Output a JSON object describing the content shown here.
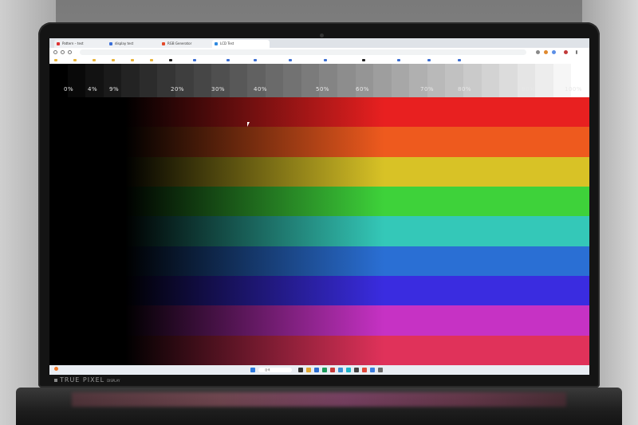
{
  "browser": {
    "tabs": [
      {
        "label": "Pattern – test"
      },
      {
        "label": "display test"
      },
      {
        "label": "RGB Generator"
      },
      {
        "label": "LCD Test"
      }
    ],
    "url": "",
    "bookmarks": [
      {
        "label": "",
        "kind": "folder"
      },
      {
        "label": "",
        "kind": "folder"
      },
      {
        "label": "",
        "kind": "folder"
      },
      {
        "label": "",
        "kind": "folder"
      },
      {
        "label": "",
        "kind": "folder"
      },
      {
        "label": "",
        "kind": "folder"
      },
      {
        "label": "",
        "kind": "dark"
      },
      {
        "label": "",
        "kind": "blue"
      },
      {
        "label": "",
        "kind": "blue"
      },
      {
        "label": "",
        "kind": "blue"
      },
      {
        "label": "",
        "kind": "blue"
      },
      {
        "label": "",
        "kind": "blue"
      },
      {
        "label": "",
        "kind": "dark"
      },
      {
        "label": "",
        "kind": "blue"
      },
      {
        "label": "",
        "kind": "blue"
      },
      {
        "label": "",
        "kind": "blue"
      }
    ]
  },
  "test_pattern": {
    "percent_labels": [
      "0%",
      "4%",
      "9%",
      "20%",
      "30%",
      "40%",
      "50%",
      "60%",
      "70%",
      "80%",
      "90%",
      "100%"
    ],
    "bands": [
      {
        "color": "#e82020"
      },
      {
        "color": "#ee5a1e"
      },
      {
        "color": "#d8c226"
      },
      {
        "color": "#3ed23a"
      },
      {
        "color": "#34c8b8"
      },
      {
        "color": "#2a6fd4"
      },
      {
        "color": "#3a2ce0"
      },
      {
        "color": "#c632c4"
      },
      {
        "color": "#e0325a"
      }
    ]
  },
  "taskbar": {
    "weather_temp": "",
    "weather_desc": "",
    "search_label": "검색",
    "clock_time": "",
    "clock_date": ""
  },
  "bezel": {
    "brand": "TRUE PIXEL",
    "brand_suffix": "DISPLAY"
  }
}
